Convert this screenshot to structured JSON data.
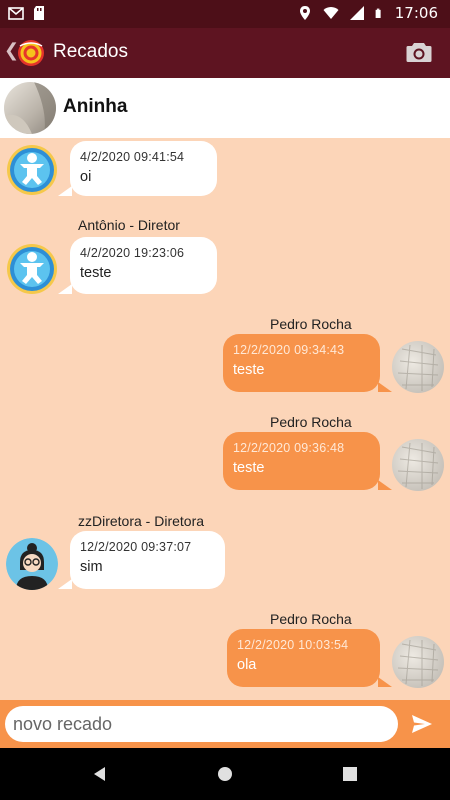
{
  "status_bar": {
    "time": "17:06"
  },
  "app_bar": {
    "title": "Recados",
    "back_glyph": "❮"
  },
  "contact": {
    "name": "Aninha"
  },
  "messages": [
    {
      "direction": "in",
      "sender": "",
      "timestamp": "4/2/2020 09:41:54",
      "text": "oi",
      "avatar": "baby-icon"
    },
    {
      "direction": "in",
      "sender": "Antônio - Diretor",
      "timestamp": "4/2/2020 19:23:06",
      "text": "teste",
      "avatar": "baby-icon"
    },
    {
      "direction": "out",
      "sender": "Pedro Rocha",
      "timestamp": "12/2/2020 09:34:43",
      "text": "teste",
      "avatar": "photo"
    },
    {
      "direction": "out",
      "sender": "Pedro Rocha",
      "timestamp": "12/2/2020 09:36:48",
      "text": "teste",
      "avatar": "photo"
    },
    {
      "direction": "in",
      "sender": "zzDiretora - Diretora",
      "timestamp": "12/2/2020 09:37:07",
      "text": "sim",
      "avatar": "woman-icon"
    },
    {
      "direction": "out",
      "sender": "Pedro Rocha",
      "timestamp": "12/2/2020 10:03:54",
      "text": "ola",
      "avatar": "photo"
    }
  ],
  "composer": {
    "placeholder": "novo recado",
    "value": ""
  },
  "colors": {
    "status_bar": "#4d0f18",
    "app_bar": "#5e1421",
    "chat_background": "#fcd5b8",
    "outgoing_bubble": "#f7934a",
    "incoming_bubble": "#ffffff"
  }
}
